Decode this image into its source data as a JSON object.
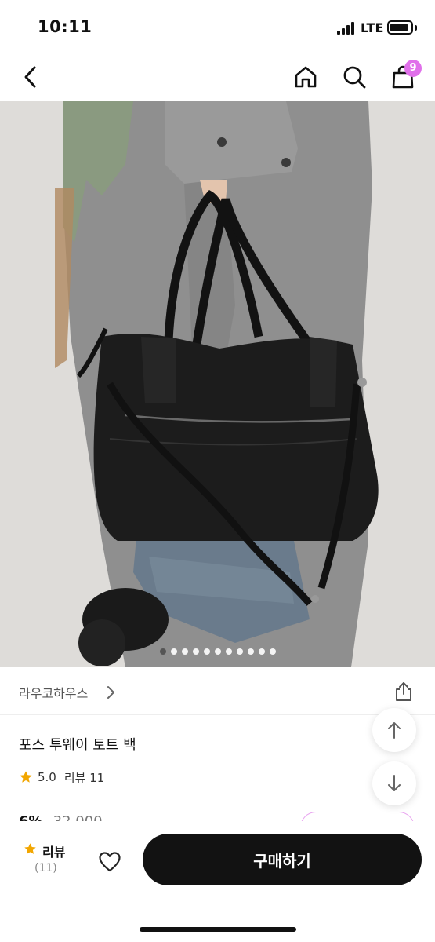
{
  "status_bar": {
    "time": "10:11",
    "network": "LTE"
  },
  "header": {
    "back_icon": "chevron-left-icon",
    "home_icon": "home-icon",
    "search_icon": "search-icon",
    "cart_icon": "shopping-bag-icon",
    "cart_count": "9"
  },
  "gallery": {
    "image_count": 11,
    "active_index": 0
  },
  "shop": {
    "name": "라우코하우스",
    "share_icon": "share-icon"
  },
  "product": {
    "title": "포스 투웨이 토트 백",
    "rating": "5.0",
    "review_link": "리뷰 11",
    "discount": "6%",
    "original_price": "32,000"
  },
  "bottom_bar": {
    "review_label": "리뷰",
    "review_count": "(11)",
    "buy_label": "구매하기"
  },
  "colors": {
    "accent": "#e070ea",
    "star": "#f2a600",
    "buy_button": "#121212"
  }
}
